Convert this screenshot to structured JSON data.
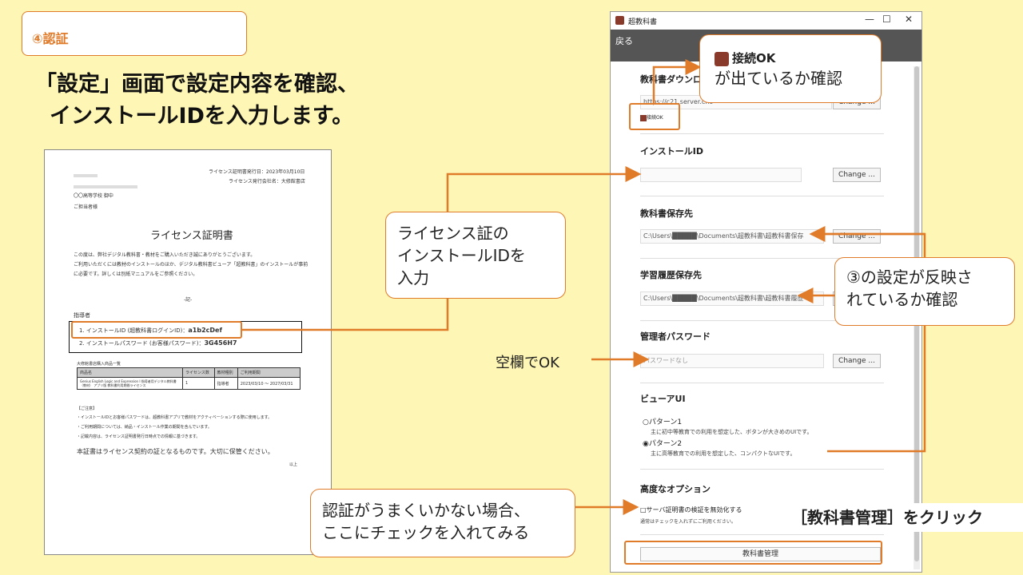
{
  "step": {
    "label": "④認証"
  },
  "heading": {
    "line1": "「設定」画面で設定内容を確認、",
    "line2": "インストールIDを入力します。"
  },
  "certificate": {
    "issue_date": "ライセンス証明書発行日：2023年03月10日",
    "issuer": "ライセンス発行会社名：大修館書店",
    "school": "〇〇高等学校 御中",
    "person": "ご担当者様",
    "title": "ライセンス証明書",
    "body1": "この度は、弊社デジタル教科書・教材をご購入いただき誠にありがとうございます。",
    "body2": "ご利用いただくには教材のインストールのほか、デジタル教科書ビューア「超教科書」のインストールが事前",
    "body3": "に必要です。詳しくは別紙マニュアルをご参照ください。",
    "note_mark": "-記-",
    "teacher_label": "指導者",
    "install_id_line": "1. インストールID (超教科書ログインID)：",
    "install_id_value": "a1b2cDef",
    "password_line": "2. インストールパスワード (お客様パスワード)：",
    "password_value": "3G456H7",
    "table_caption": "大修館書店購入商品一覧",
    "table_headers": [
      "商品名",
      "ライセンス数",
      "教材種別",
      "ご利用期間"
    ],
    "table_row": [
      "Genius English Logic and Expression I 指導者用デジタル教科書（教材） アプリ版 教科書利用期間ライセンス",
      "1",
      "指導者",
      "2023/03/10 〜 2027/03/31"
    ],
    "notes_title": "【ご注意】",
    "note1": "・インストールIDとお客様パスワードは、超教科書アプリで教材をアクティベーションする際に使用します。",
    "note2": "・ご利用期間については、納品・インストール作業の期間を含んでいます。",
    "note3": "・記載内容は、ライセンス証明書発行日時点での情報に基づきます。",
    "footer": "本証書はライセンス契約の証となるものです。大切に保管ください。",
    "end": "以上"
  },
  "callouts": {
    "license": [
      "ライセンス証の",
      "インストールIDを",
      "入力"
    ],
    "reflect": [
      "③の設定が反映さ",
      "れているか確認"
    ],
    "connect_badge": "接続OK",
    "connect_text": "が出ているか確認",
    "auth": [
      "認証がうまくいかない場合、",
      "ここにチェックを入れてみる"
    ],
    "blank_ok": "空欄でOK",
    "click": "［教科書管理］をクリック"
  },
  "window": {
    "title": "超教科書",
    "controls": [
      "—",
      "☐",
      "✕"
    ],
    "back": "戻る",
    "download_label": "教科書ダウンロ",
    "server_url": "https://c21.server.cho",
    "connect_ok": "接続OK",
    "install_id_label": "インストールID",
    "install_id_value": "",
    "save_label": "教科書保存先",
    "save_path": "C:\\Users\\█████\\Documents\\超教科書\\超教科書保存",
    "history_label": "学習履歴保存先",
    "history_path": "C:\\Users\\█████\\Documents\\超教科書\\超教科書履歴",
    "admin_pw_label": "管理者パスワード",
    "admin_pw_placeholder": "パスワードなし",
    "change": "Change ...",
    "viewer_label": "ビューアUI",
    "pattern1": "○パターン1",
    "pattern1_desc": "主に初中等教育での利用を想定した、ボタンが大きめのUIです。",
    "pattern2": "◉パターン2",
    "pattern2_desc": "主に高等教育での利用を想定した、コンパクトなUIです。",
    "advanced_label": "高度なオプション",
    "server_cert": "□サーバ証明書の検証を無効化する",
    "server_cert_desc": "通常はチェックを入れずにご利用ください。",
    "manage_button": "教科書管理"
  },
  "colors": {
    "background": "#fef6b4",
    "accent": "#e07b2a"
  }
}
